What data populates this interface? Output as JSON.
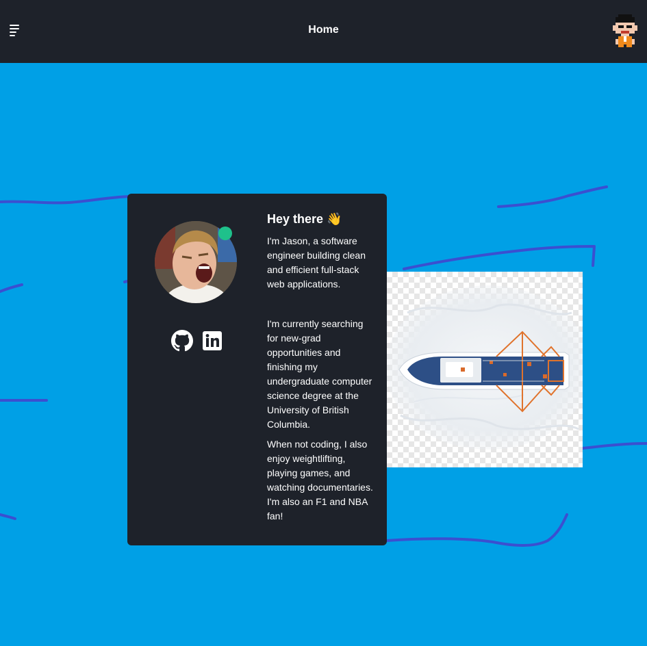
{
  "header": {
    "title": "Home",
    "menu_icon": "hamburger-menu-icon",
    "avatar_icon": "pixel-character-avatar"
  },
  "intro_card": {
    "heading": "Hey there 👋",
    "paragraphs": [
      "I'm Jason, a software engineer building clean and efficient full-stack web applications.",
      "I'm currently searching for new-grad opportunities and finishing my undergraduate computer science degree at the University of British Columbia.",
      "When not coding, I also enjoy weightlifting, playing games, and watching documentaries. I'm also an F1 and NBA fan!"
    ],
    "status": "online",
    "social_icons": [
      "github-icon",
      "linkedin-icon"
    ]
  },
  "colors": {
    "background": "#00a0e6",
    "header_bg": "#1e222a",
    "card_bg": "#1e222a",
    "online_status": "#1fc18b",
    "wave_lines": "#3b4fd0"
  }
}
